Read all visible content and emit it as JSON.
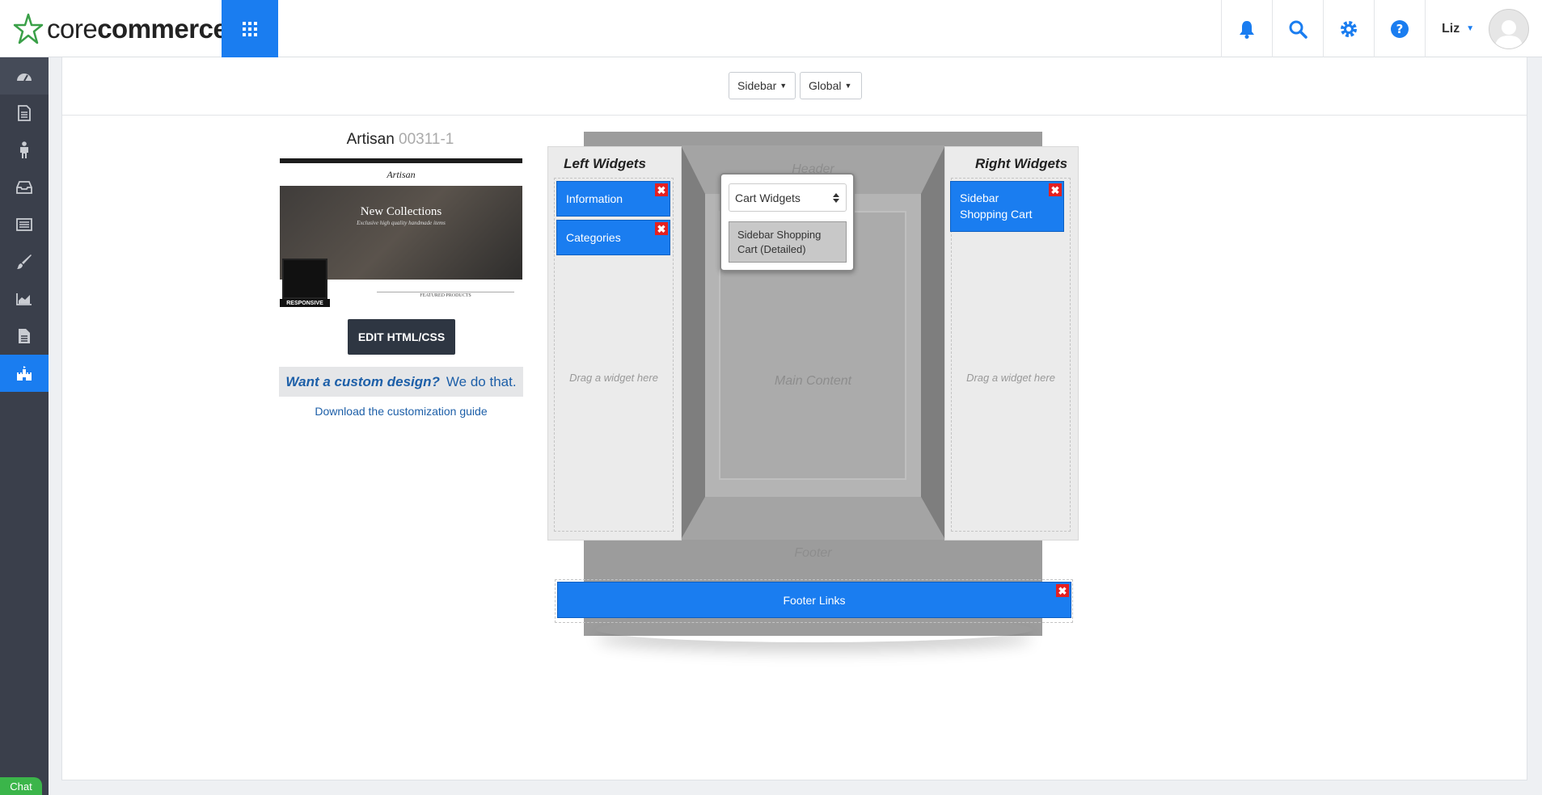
{
  "brand": {
    "core": "core",
    "commerce": "commerce"
  },
  "header": {
    "user_name": "Liz"
  },
  "toolbar": {
    "sidebar_dropdown": "Sidebar",
    "global_dropdown": "Global"
  },
  "theme": {
    "name": "Artisan",
    "code": "00311-1",
    "preview": {
      "hero_title": "New Collections",
      "hero_subtitle": "Exclusive high quality handmade items",
      "brand": "Artisan",
      "badge": "RESPONSIVE",
      "featured": "FEATURED PRODUCTS"
    },
    "edit_button": "EDIT HTML/CSS",
    "custom_prompt": "Want a custom design?",
    "custom_answer": "We do that.",
    "download_link": "Download the customization guide"
  },
  "layout": {
    "left_title": "Left Widgets",
    "right_title": "Right Widgets",
    "header_label": "Header",
    "main_label": "Main Content",
    "footer_label": "Footer",
    "drag_hint": "Drag a widget here",
    "left_widgets": [
      {
        "label": "Information"
      },
      {
        "label": "Categories"
      }
    ],
    "right_widgets": [
      {
        "label": "Sidebar Shopping Cart"
      }
    ],
    "footer_widget": "Footer Links"
  },
  "popup": {
    "select_value": "Cart Widgets",
    "item": "Sidebar Shopping Cart (Detailed)"
  },
  "chat": "Chat"
}
